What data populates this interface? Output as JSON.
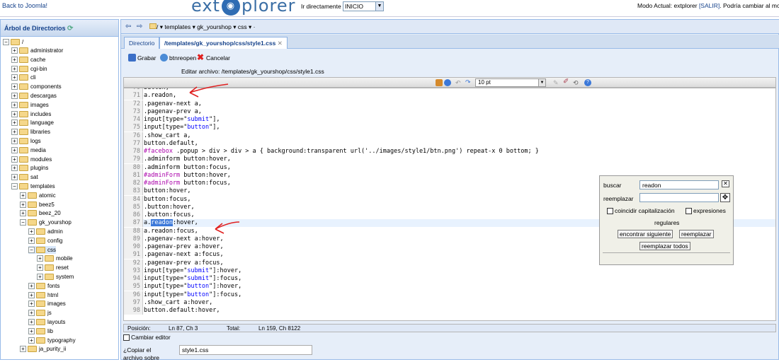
{
  "topbar": {
    "back_link": "Back to Joomla!",
    "logo_left": "ext",
    "logo_right": "plorer",
    "goto_label": "Ir directamente a:",
    "goto_value": "INICIO",
    "mode_text": "Modo Actual: extplorer ",
    "mode_link": "[SALIR]",
    "mode_tail": ". Podría cambiar al modo f"
  },
  "tree": {
    "title": "Árbol de Directorios",
    "root": "/",
    "items": [
      {
        "label": "administrator",
        "level": 1
      },
      {
        "label": "cache",
        "level": 1
      },
      {
        "label": "cgi-bin",
        "level": 1
      },
      {
        "label": "cli",
        "level": 1
      },
      {
        "label": "components",
        "level": 1
      },
      {
        "label": "descargas",
        "level": 1
      },
      {
        "label": "images",
        "level": 1
      },
      {
        "label": "includes",
        "level": 1
      },
      {
        "label": "language",
        "level": 1
      },
      {
        "label": "libraries",
        "level": 1
      },
      {
        "label": "logs",
        "level": 1
      },
      {
        "label": "media",
        "level": 1
      },
      {
        "label": "modules",
        "level": 1
      },
      {
        "label": "plugins",
        "level": 1
      },
      {
        "label": "sat",
        "level": 1
      },
      {
        "label": "templates",
        "level": 1,
        "open": true
      },
      {
        "label": "atomic",
        "level": 2
      },
      {
        "label": "beez5",
        "level": 2
      },
      {
        "label": "beez_20",
        "level": 2
      },
      {
        "label": "gk_yourshop",
        "level": 2,
        "open": true
      },
      {
        "label": "admin",
        "level": 3
      },
      {
        "label": "config",
        "level": 3
      },
      {
        "label": "css",
        "level": 3,
        "open": true,
        "selected": true
      },
      {
        "label": "mobile",
        "level": 4
      },
      {
        "label": "reset",
        "level": 4
      },
      {
        "label": "system",
        "level": 4
      },
      {
        "label": "fonts",
        "level": 3
      },
      {
        "label": "html",
        "level": 3
      },
      {
        "label": "images",
        "level": 3
      },
      {
        "label": "js",
        "level": 3
      },
      {
        "label": "layouts",
        "level": 3
      },
      {
        "label": "lib",
        "level": 3
      },
      {
        "label": "typography",
        "level": 3
      },
      {
        "label": "ja_purity_ii",
        "level": 2
      }
    ]
  },
  "pathbar": {
    "crumbs": "/ ▾  templates ▾  gk_yourshop ▾  css ▾ ·"
  },
  "tabs": {
    "directory": "Directorio",
    "file": "/templates/gk_yourshop/css/style1.css"
  },
  "toolbar": {
    "save": "Grabar",
    "reopen": "btnreopen",
    "cancel": "Cancelar",
    "edit_label": "Editar archivo: /templates/gk_yourshop/css/style1.css",
    "font_size": "10 pt"
  },
  "editor": {
    "lines": [
      {
        "n": "70",
        "text": "button,"
      },
      {
        "n": "71",
        "text": "a.readon,"
      },
      {
        "n": "72",
        "text": ".pagenav-next a,"
      },
      {
        "n": "73",
        "text": ".pagenav-prev a,"
      },
      {
        "n": "74",
        "text": "input[type=\"submit\"],"
      },
      {
        "n": "75",
        "text": "input[type=\"button\"],"
      },
      {
        "n": "76",
        "text": ".show_cart a,"
      },
      {
        "n": "77",
        "text": "button.default,"
      },
      {
        "n": "78",
        "text": "#facebox .popup > div > div > a { background:transparent url('../images/style1/btn.png') repeat-x 0 bottom; }"
      },
      {
        "n": "79",
        "text": ".adminform button:hover,"
      },
      {
        "n": "80",
        "text": ".adminform button:focus,"
      },
      {
        "n": "81",
        "text": "#adminForm button:hover,"
      },
      {
        "n": "82",
        "text": "#adminForm button:focus,"
      },
      {
        "n": "83",
        "text": "button:hover,"
      },
      {
        "n": "84",
        "text": "button:focus,"
      },
      {
        "n": "85",
        "text": ".button:hover,"
      },
      {
        "n": "86",
        "text": ".button:focus,"
      },
      {
        "n": "87",
        "text": "a.readon:hover,"
      },
      {
        "n": "88",
        "text": "a.readon:focus,"
      },
      {
        "n": "89",
        "text": ".pagenav-next a:hover,"
      },
      {
        "n": "90",
        "text": ".pagenav-prev a:hover,"
      },
      {
        "n": "91",
        "text": ".pagenav-next a:focus,"
      },
      {
        "n": "92",
        "text": ".pagenav-prev a:focus,"
      },
      {
        "n": "93",
        "text": "input[type=\"submit\"]:hover,"
      },
      {
        "n": "94",
        "text": "input[type=\"submit\"]:focus,"
      },
      {
        "n": "95",
        "text": "input[type=\"button\"]:hover,"
      },
      {
        "n": "96",
        "text": "input[type=\"button\"]:focus,"
      },
      {
        "n": "97",
        "text": ".show_cart a:hover,"
      },
      {
        "n": "98",
        "text": "button.default:hover,"
      }
    ]
  },
  "status": {
    "pos_label": "Posición:",
    "pos_value": "Ln 87, Ch 3",
    "total_label": "Total:",
    "total_value": "Ln 159, Ch 8122"
  },
  "bottom": {
    "toggle_editor": "Cambiar editor",
    "copy_label": "¿Copiar el archivo sobre",
    "copy_value": "style1.css"
  },
  "find": {
    "search_label": "buscar",
    "search_value": "readon",
    "replace_label": "reemplazar",
    "replace_value": "",
    "case_label": "coincidir capitalización",
    "regex_label": "expresiones",
    "regex_label2": "regulares",
    "find_next": "encontrar siguiente",
    "replace_btn": "reemplazar",
    "replace_all": "reemplazar todos",
    "close": "✕"
  },
  "colors": {
    "accent": "#15428b",
    "panel_border": "#99bbe8",
    "highlight": "#3b78d9",
    "arrow": "#e02020"
  }
}
